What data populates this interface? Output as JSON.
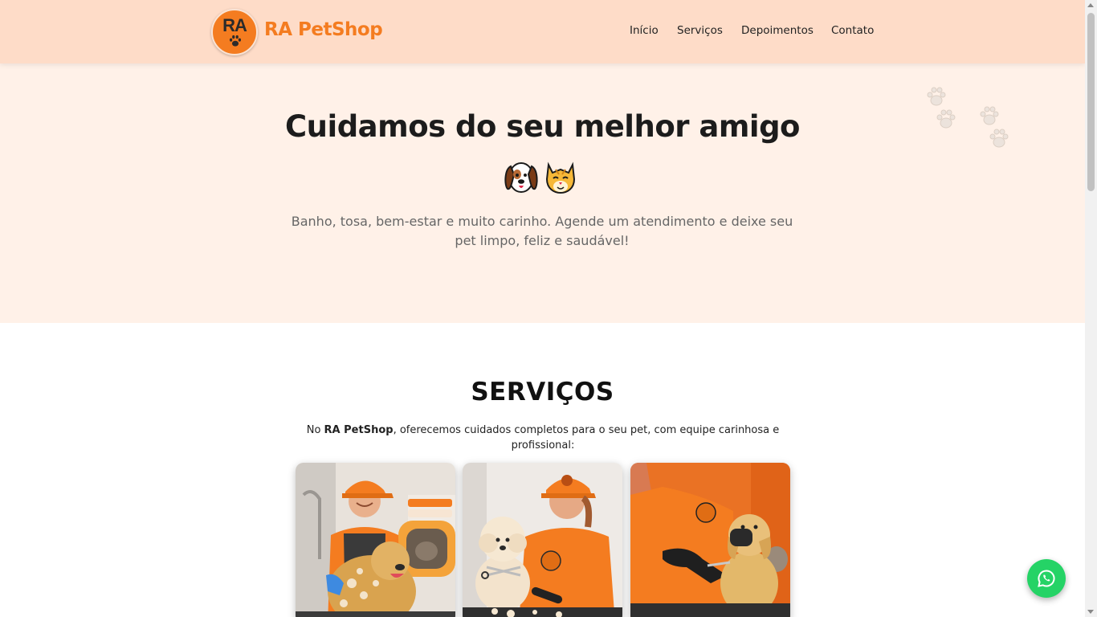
{
  "header": {
    "logo_text": "RA",
    "brand": "RA PetShop",
    "nav": [
      "Início",
      "Serviços",
      "Depoimentos",
      "Contato"
    ]
  },
  "hero": {
    "title": "Cuidamos do seu melhor amigo",
    "emoji_icons": [
      "dog-face-icon",
      "cat-face-icon"
    ],
    "subtitle": "Banho, tosa, bem-estar e muito carinho. Agende um atendimento e deixe seu pet limpo, feliz e saudável!"
  },
  "services": {
    "title": "SERVIÇOS",
    "desc_prefix": "No ",
    "desc_brand": "RA PetShop",
    "desc_suffix": ", oferecemos cuidados completos para o seu pet, com equipe carinhosa e profissional:"
  },
  "colors": {
    "accent": "#f47c20",
    "header_bg": "#fedcc8",
    "hero_bg": "#fff1e8",
    "whatsapp": "#25d366"
  },
  "floating": {
    "icon": "whatsapp-icon"
  }
}
